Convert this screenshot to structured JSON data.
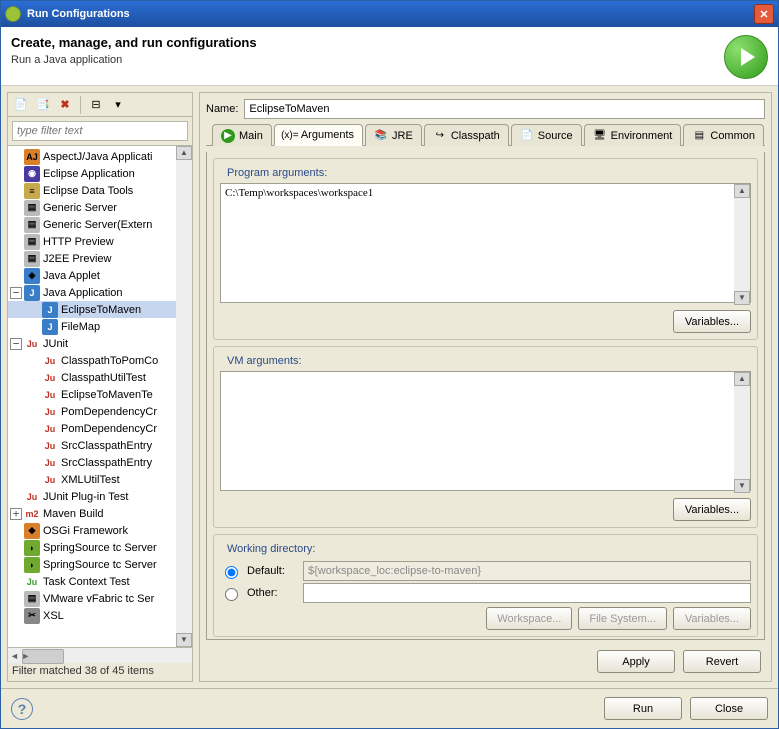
{
  "title": "Run Configurations",
  "header": {
    "title": "Create, manage, and run configurations",
    "subtitle": "Run a Java application"
  },
  "left": {
    "filter_placeholder": "type filter text",
    "status": "Filter matched 38 of 45 items",
    "tree": [
      {
        "label": "AspectJ/Java Applicati",
        "icon": "aj",
        "depth": 1,
        "exp": ""
      },
      {
        "label": "Eclipse Application",
        "icon": "ecl",
        "depth": 1,
        "exp": ""
      },
      {
        "label": "Eclipse Data Tools",
        "icon": "db",
        "depth": 1,
        "exp": ""
      },
      {
        "label": "Generic Server",
        "icon": "srv",
        "depth": 1,
        "exp": ""
      },
      {
        "label": "Generic Server(Extern",
        "icon": "srv",
        "depth": 1,
        "exp": ""
      },
      {
        "label": "HTTP Preview",
        "icon": "http",
        "depth": 1,
        "exp": ""
      },
      {
        "label": "J2EE Preview",
        "icon": "j2ee",
        "depth": 1,
        "exp": ""
      },
      {
        "label": "Java Applet",
        "icon": "japp",
        "depth": 1,
        "exp": ""
      },
      {
        "label": "Java Application",
        "icon": "java",
        "depth": 1,
        "exp": "minus"
      },
      {
        "label": "EclipseToMaven",
        "icon": "java",
        "depth": 2,
        "exp": "",
        "selected": true
      },
      {
        "label": "FileMap",
        "icon": "java",
        "depth": 2,
        "exp": ""
      },
      {
        "label": "JUnit",
        "icon": "ju",
        "depth": 1,
        "exp": "minus"
      },
      {
        "label": "ClasspathToPomCo",
        "icon": "ju",
        "depth": 2,
        "exp": ""
      },
      {
        "label": "ClasspathUtilTest",
        "icon": "ju",
        "depth": 2,
        "exp": ""
      },
      {
        "label": "EclipseToMavenTe",
        "icon": "ju",
        "depth": 2,
        "exp": ""
      },
      {
        "label": "PomDependencyCr",
        "icon": "ju",
        "depth": 2,
        "exp": ""
      },
      {
        "label": "PomDependencyCr",
        "icon": "ju",
        "depth": 2,
        "exp": ""
      },
      {
        "label": "SrcClasspathEntry",
        "icon": "ju",
        "depth": 2,
        "exp": ""
      },
      {
        "label": "SrcClasspathEntry",
        "icon": "ju",
        "depth": 2,
        "exp": ""
      },
      {
        "label": "XMLUtilTest",
        "icon": "ju",
        "depth": 2,
        "exp": ""
      },
      {
        "label": "JUnit Plug-in Test",
        "icon": "jup",
        "depth": 1,
        "exp": ""
      },
      {
        "label": "Maven Build",
        "icon": "m2",
        "depth": 1,
        "exp": "plus"
      },
      {
        "label": "OSGi Framework",
        "icon": "osgi",
        "depth": 1,
        "exp": ""
      },
      {
        "label": "SpringSource tc Server",
        "icon": "ss",
        "depth": 1,
        "exp": ""
      },
      {
        "label": "SpringSource tc Server",
        "icon": "ss",
        "depth": 1,
        "exp": ""
      },
      {
        "label": "Task Context Test",
        "icon": "tct",
        "depth": 1,
        "exp": ""
      },
      {
        "label": "VMware vFabric tc Ser",
        "icon": "vm",
        "depth": 1,
        "exp": ""
      },
      {
        "label": "XSL",
        "icon": "xsl",
        "depth": 1,
        "exp": ""
      }
    ]
  },
  "right": {
    "name_label": "Name:",
    "name_value": "EclipseToMaven",
    "tabs": [
      {
        "id": "main",
        "label": "Main"
      },
      {
        "id": "arguments",
        "label": "Arguments",
        "active": true
      },
      {
        "id": "jre",
        "label": "JRE"
      },
      {
        "id": "classpath",
        "label": "Classpath"
      },
      {
        "id": "source",
        "label": "Source"
      },
      {
        "id": "environment",
        "label": "Environment"
      },
      {
        "id": "common",
        "label": "Common"
      }
    ],
    "program_args_label": "Program arguments:",
    "program_args_value": "C:\\Temp\\workspaces\\workspace1",
    "vm_args_label": "VM arguments:",
    "vm_args_value": "",
    "variables_btn": "Variables...",
    "working_dir_label": "Working directory:",
    "default_label": "Default:",
    "default_value": "${workspace_loc:eclipse-to-maven}",
    "other_label": "Other:",
    "other_value": "",
    "workspace_btn": "Workspace...",
    "filesystem_btn": "File System...",
    "apply_btn": "Apply",
    "revert_btn": "Revert"
  },
  "footer": {
    "run": "Run",
    "close": "Close"
  }
}
